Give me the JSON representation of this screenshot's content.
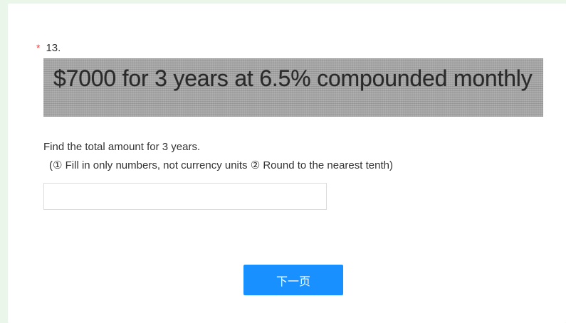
{
  "question": {
    "required_mark": "*",
    "number": "13.",
    "image_text": "$7000 for 3 years at 6.5% compounded monthly",
    "prompt": "Find the total amount for 3 years.",
    "hint": "(① Fill in only numbers, not currency units ② Round to the nearest tenth)"
  },
  "answer": {
    "value": "",
    "placeholder": ""
  },
  "navigation": {
    "next_label": "下一页"
  },
  "colors": {
    "background": "#eaf6ea",
    "card": "#ffffff",
    "required_star": "#e04848",
    "button": "#1890ff"
  }
}
